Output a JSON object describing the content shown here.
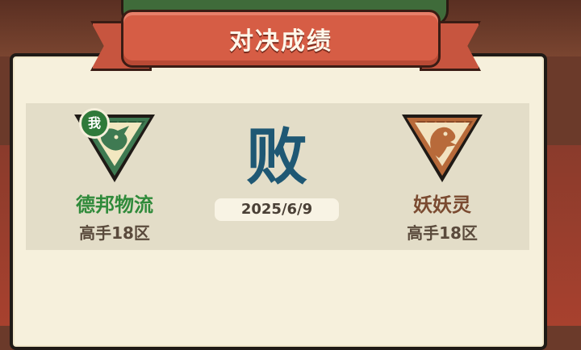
{
  "header": {
    "title": "对决成绩"
  },
  "result": {
    "outcome": "败",
    "date": "2025/6/9"
  },
  "players": {
    "self": {
      "badge": "我",
      "name": "德邦物流",
      "server": "高手18区",
      "emblem": "rhino-emblem-icon"
    },
    "opponent": {
      "name": "妖妖灵",
      "server": "高手18区",
      "emblem": "bird-emblem-icon"
    }
  },
  "colors": {
    "ribbon": "#d65d45",
    "panel": "#f6f0dc",
    "self_name": "#2f8a3a",
    "opponent_name": "#7a4a30",
    "result": "#1f5874"
  }
}
